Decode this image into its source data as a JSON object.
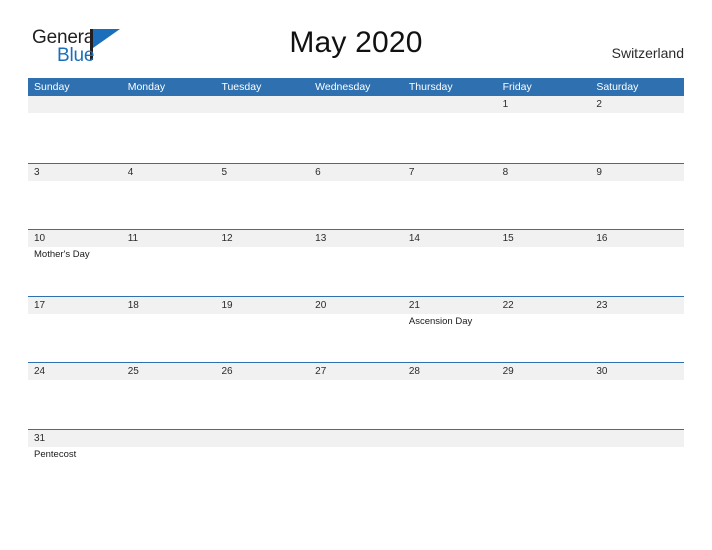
{
  "logo": {
    "word_one": "General",
    "word_two": "Blue",
    "flag_icon": "flag-triangle-icon",
    "colors": {
      "dark": "#231f20",
      "blue": "#1b6fba"
    }
  },
  "header": {
    "title": "May 2020",
    "country": "Switzerland"
  },
  "theme": {
    "header_blue": "#2e70b0",
    "row_divider_blue": "#2e70b0",
    "band_gray": "#f1f1f1",
    "page_background": "#ffffff"
  },
  "calendar": {
    "month": "May",
    "year": "2020",
    "day_headers": [
      "Sunday",
      "Monday",
      "Tuesday",
      "Wednesday",
      "Thursday",
      "Friday",
      "Saturday"
    ],
    "weeks": [
      {
        "days": [
          {
            "num": "",
            "event": ""
          },
          {
            "num": "",
            "event": ""
          },
          {
            "num": "",
            "event": ""
          },
          {
            "num": "",
            "event": ""
          },
          {
            "num": "",
            "event": ""
          },
          {
            "num": "1",
            "event": ""
          },
          {
            "num": "2",
            "event": ""
          }
        ]
      },
      {
        "days": [
          {
            "num": "3",
            "event": ""
          },
          {
            "num": "4",
            "event": ""
          },
          {
            "num": "5",
            "event": ""
          },
          {
            "num": "6",
            "event": ""
          },
          {
            "num": "7",
            "event": ""
          },
          {
            "num": "8",
            "event": ""
          },
          {
            "num": "9",
            "event": ""
          }
        ]
      },
      {
        "days": [
          {
            "num": "10",
            "event": "Mother's Day"
          },
          {
            "num": "11",
            "event": ""
          },
          {
            "num": "12",
            "event": ""
          },
          {
            "num": "13",
            "event": ""
          },
          {
            "num": "14",
            "event": ""
          },
          {
            "num": "15",
            "event": ""
          },
          {
            "num": "16",
            "event": ""
          }
        ]
      },
      {
        "days": [
          {
            "num": "17",
            "event": ""
          },
          {
            "num": "18",
            "event": ""
          },
          {
            "num": "19",
            "event": ""
          },
          {
            "num": "20",
            "event": ""
          },
          {
            "num": "21",
            "event": "Ascension Day"
          },
          {
            "num": "22",
            "event": ""
          },
          {
            "num": "23",
            "event": ""
          }
        ]
      },
      {
        "days": [
          {
            "num": "24",
            "event": ""
          },
          {
            "num": "25",
            "event": ""
          },
          {
            "num": "26",
            "event": ""
          },
          {
            "num": "27",
            "event": ""
          },
          {
            "num": "28",
            "event": ""
          },
          {
            "num": "29",
            "event": ""
          },
          {
            "num": "30",
            "event": ""
          }
        ]
      },
      {
        "days": [
          {
            "num": "31",
            "event": "Pentecost"
          },
          {
            "num": "",
            "event": ""
          },
          {
            "num": "",
            "event": ""
          },
          {
            "num": "",
            "event": ""
          },
          {
            "num": "",
            "event": ""
          },
          {
            "num": "",
            "event": ""
          },
          {
            "num": "",
            "event": ""
          }
        ]
      }
    ]
  }
}
